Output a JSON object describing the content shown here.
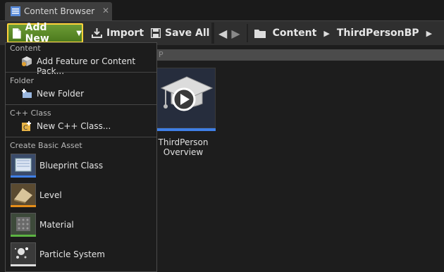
{
  "tab": {
    "title": "Content Browser",
    "close": "✕"
  },
  "toolbar": {
    "add_new": "Add New",
    "import": "Import",
    "save_all": "Save All",
    "back": "◀",
    "forward": "▶"
  },
  "breadcrumb": {
    "items": [
      "Content",
      "ThirdPersonBP"
    ],
    "sep": "▶"
  },
  "filter": {
    "text": "P"
  },
  "asset_tile": {
    "label_line1": "ThirdPerson",
    "label_line2": "Overview",
    "accent": "#3f7fe6"
  },
  "menu": {
    "sections": [
      {
        "heading": "Content",
        "items": [
          "Add Feature or Content Pack..."
        ]
      },
      {
        "heading": "Folder",
        "items": [
          "New Folder"
        ]
      },
      {
        "heading": "C++ Class",
        "items": [
          "New C++ Class..."
        ]
      },
      {
        "heading": "Create Basic Asset"
      }
    ],
    "basic_assets": [
      {
        "label": "Blueprint Class",
        "color": "#3f7fe6"
      },
      {
        "label": "Level",
        "color": "#e58d19"
      },
      {
        "label": "Material",
        "color": "#5cb342"
      },
      {
        "label": "Particle System",
        "color": "#dddddd"
      }
    ]
  }
}
